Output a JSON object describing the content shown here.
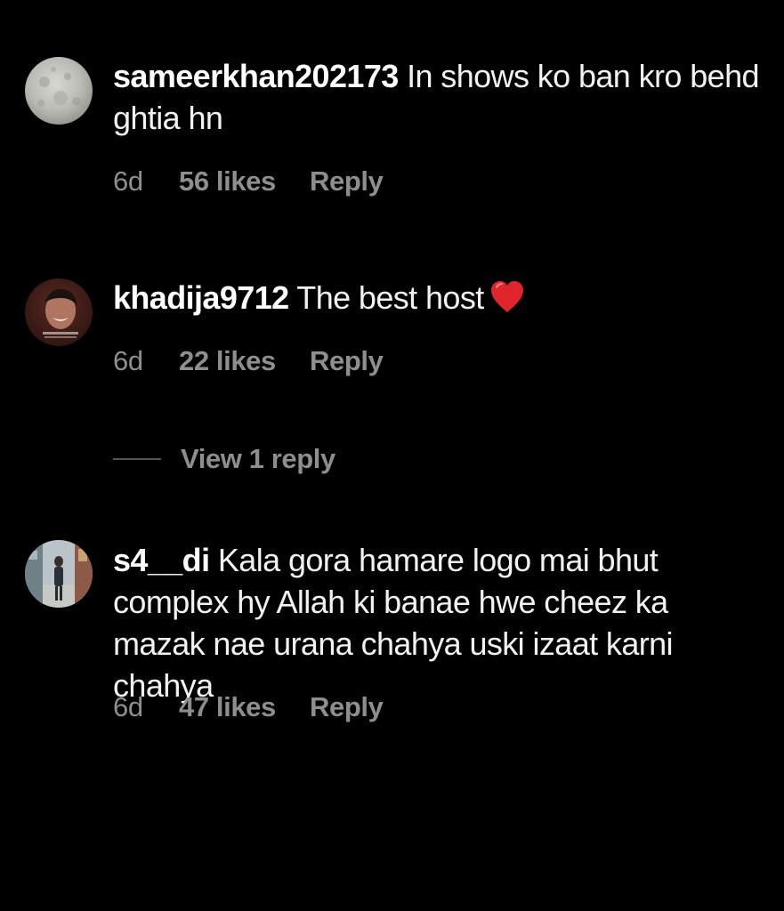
{
  "comments": [
    {
      "username": "sameerkhan202173",
      "text": " In shows ko ban kro behd ghtia hn",
      "time": "6d",
      "likes": "56 likes",
      "reply_label": "Reply",
      "avatar_icon": "moon-photo-avatar"
    },
    {
      "username": "khadija9712",
      "text": " The best host",
      "emoji": "heart-icon",
      "time": "6d",
      "likes": "22 likes",
      "reply_label": "Reply",
      "avatar_icon": "smiling-man-photo-avatar"
    },
    {
      "username": "s4__di",
      "text": " Kala gora hamare logo mai bhut complex hy Allah ki banae hwe cheez ka mazak nae urana chahya uski izaat karni chahya",
      "time": "6d",
      "likes": "47 likes",
      "reply_label": "Reply",
      "avatar_icon": "street-photo-avatar"
    }
  ],
  "view_replies_label": "View 1 reply",
  "colors": {
    "background": "#000000",
    "text": "#f2f2f2",
    "meta": "#8e8e8e",
    "heart": "#e0242b"
  }
}
